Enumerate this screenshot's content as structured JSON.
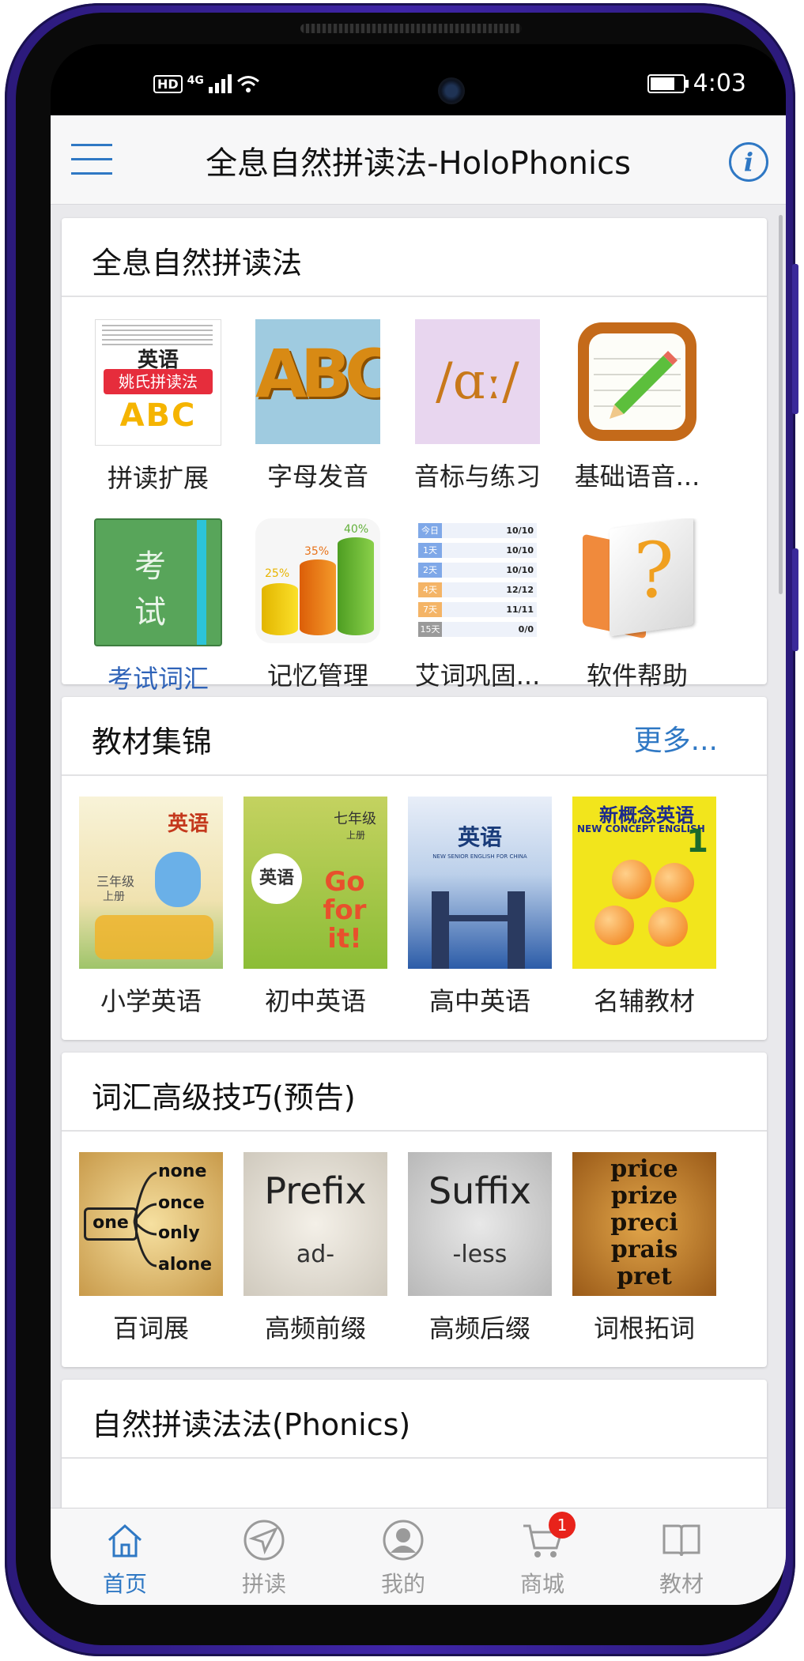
{
  "status_bar": {
    "hd": "HD",
    "network": "4G",
    "time": "4:03"
  },
  "header": {
    "title": "全息自然拼读法-HoloPhonics"
  },
  "sections": [
    {
      "title": "全息自然拼读法",
      "items": [
        {
          "label": "拼读扩展",
          "thumb_text": "英语",
          "thumb_sub": "姚氏拼读法",
          "thumb_abc": "ABC"
        },
        {
          "label": "字母发音",
          "thumb_text": "ABC"
        },
        {
          "label": "音标与练习",
          "thumb_text": "/ɑː/"
        },
        {
          "label": "基础语音..."
        },
        {
          "label": "考试词汇",
          "thumb_text": "考",
          "thumb_text2": "试"
        },
        {
          "label": "记忆管理",
          "pct": [
            "25%",
            "35%",
            "40%"
          ]
        },
        {
          "label": "艾词巩固...",
          "rows": [
            {
              "d": "今日",
              "v": "10/10"
            },
            {
              "d": "1天",
              "v": "10/10"
            },
            {
              "d": "2天",
              "v": "10/10"
            },
            {
              "d": "4天",
              "v": "12/12"
            },
            {
              "d": "7天",
              "v": "11/11"
            },
            {
              "d": "15天",
              "v": "0/0"
            }
          ]
        },
        {
          "label": "软件帮助",
          "thumb_text": "?"
        }
      ]
    },
    {
      "title": "教材集锦",
      "more": "更多...",
      "items": [
        {
          "label": "小学英语",
          "thumb_text": "英语",
          "thumb_sub": "三年级",
          "thumb_sub2": "上册"
        },
        {
          "label": "初中英语",
          "thumb_text": "英语",
          "thumb_sub": "七年级",
          "thumb_sub2": "上册",
          "thumb_go": "Go for it!"
        },
        {
          "label": "高中英语",
          "thumb_text": "英语",
          "thumb_sub": "NEW SENIOR ENGLISH FOR CHINA"
        },
        {
          "label": "名辅教材",
          "thumb_text": "新概念英语",
          "thumb_sub": "NEW CONCEPT ENGLISH",
          "thumb_num": "1"
        }
      ]
    },
    {
      "title": "词汇高级技巧(预告)",
      "items": [
        {
          "label": "百词展",
          "root": "one",
          "words": [
            "none",
            "once",
            "only",
            "alone"
          ]
        },
        {
          "label": "高频前缀",
          "big": "Prefix",
          "small": "ad-"
        },
        {
          "label": "高频后缀",
          "big": "Suffix",
          "small": "-less"
        },
        {
          "label": "词根拓词",
          "words": [
            "price",
            "prize",
            "preci",
            "prais",
            "pret"
          ]
        }
      ]
    },
    {
      "title": "自然拼读法法(Phonics)"
    }
  ],
  "tabs": [
    {
      "label": "首页",
      "icon": "home-icon",
      "active": true
    },
    {
      "label": "拼读",
      "icon": "plane-logo-icon"
    },
    {
      "label": "我的",
      "icon": "user-icon"
    },
    {
      "label": "商城",
      "icon": "cart-icon",
      "badge": "1"
    },
    {
      "label": "教材",
      "icon": "book-icon"
    }
  ],
  "colors": {
    "accent": "#2f78c4",
    "active_label": "#2f63b8",
    "badge": "#e8231b"
  }
}
